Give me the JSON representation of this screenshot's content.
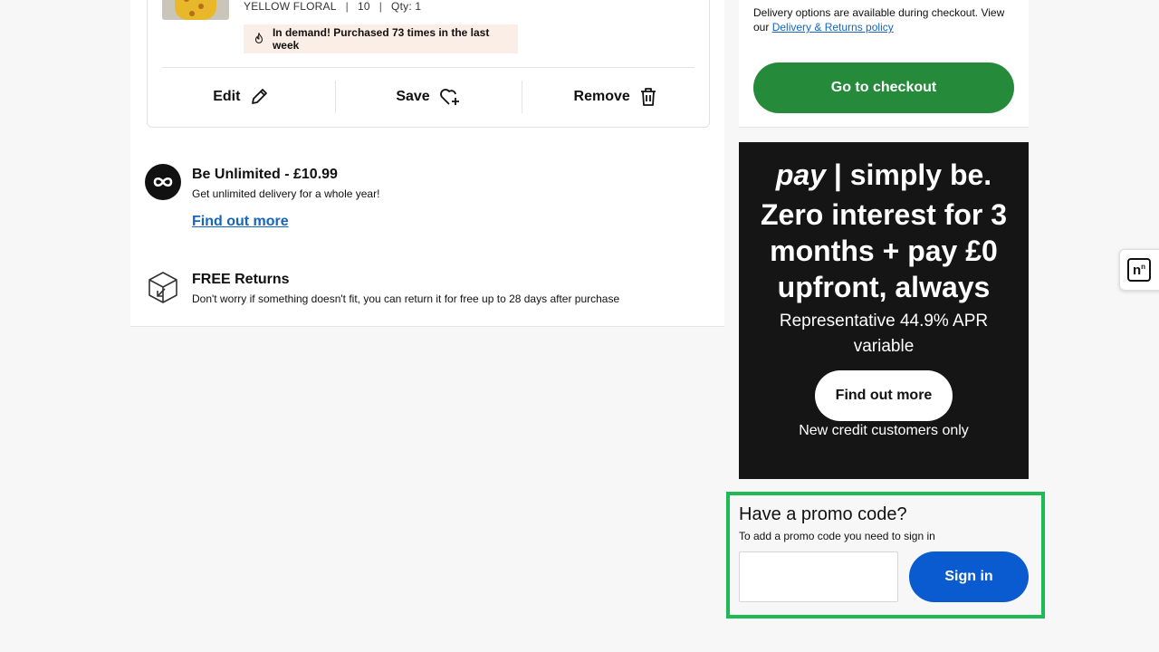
{
  "basket_item": {
    "variant": {
      "colour": "YELLOW FLORAL",
      "size": "10",
      "qty": "Qty: 1",
      "separator": "|"
    },
    "demand_text": "In demand! Purchased 73 times in the last week",
    "actions": {
      "edit_label": "Edit",
      "save_label": "Save",
      "remove_label": "Remove"
    }
  },
  "perks": {
    "unlimited": {
      "title": "Be Unlimited - £10.99",
      "subtitle": "Get unlimited delivery for a whole year!",
      "link": "Find out more"
    },
    "returns": {
      "title": "FREE Returns",
      "subtitle": "Don't worry if something doesn't fit, you can return it for free up to 28 days after purchase"
    }
  },
  "checkout": {
    "delivery_text": "Delivery options are available during checkout. View our",
    "delivery_link": "Delivery & Returns policy",
    "button_label": "Go to checkout"
  },
  "pay_banner": {
    "logo_pay": "pay",
    "logo_rest": "| simply be.",
    "headline": "Zero interest for 3 months + pay £0 upfront, always",
    "apr": "Representative 44.9% APR variable",
    "button_label": "Find out more",
    "note": "New credit customers only"
  },
  "promo": {
    "title": "Have a promo code?",
    "subtitle": "To add a promo code you need to sign in",
    "input_value": "",
    "input_placeholder": "",
    "signin_label": "Sign in"
  },
  "side_widget": {
    "letter": "n",
    "superscript": "n"
  },
  "colors": {
    "checkout_green": "#268a3b",
    "signin_blue": "#0a5bd0",
    "link_blue": "#1565c0",
    "promo_highlight": "#1eba55",
    "banner_black": "#151515"
  }
}
